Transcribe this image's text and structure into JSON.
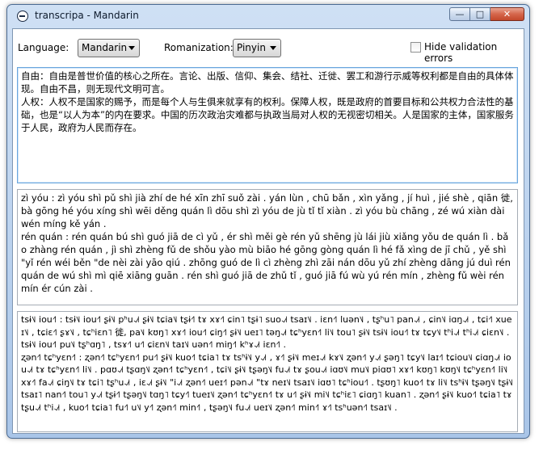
{
  "window": {
    "title": "transcripa - Mandarin",
    "min_glyph": "—",
    "max_glyph": "□",
    "close_glyph": "✕"
  },
  "toolbar": {
    "language_label": "Language:",
    "language_value": "Mandarin",
    "romanization_label": "Romanization:",
    "romanization_value": "Pinyin",
    "hide_validation_label": "Hide validation errors",
    "hide_validation_checked": false
  },
  "source_text": "自由：自由是普世价值的核心之所在。言论、出版、信仰、集会、结社、迁徙、罢工和游行示威等权利都是自由的具体体现。自由不昌，则无现代文明可言。\n人权：人权不是国家的赐予，而是每个人与生俱来就享有的权利。保障人权，既是政府的首要目标和公共权力合法性的基础，也是“以人为本”的内在要求。中国的历次政治灾难都与执政当局对人权的无视密切相关。人是国家的主体，国家服务于人民，政府为人民而存在。",
  "pinyin_text": "zì yóu : zì yóu shì pǔ shì jià zhí de hé xīn zhī suǒ zài . yán lùn , chū bǎn , xìn yǎng , jí huì , jié shè , qiān 徙, bà gōng hé yóu xíng shì wēi děng quán lì dōu shì zì yóu de jù tǐ tǐ xiàn . zì yóu bù chāng , zé wú xiàn dài wén míng kě yán .\nrén quán : rén quán bú shì guó jiā de cì yǔ , ér shì měi gè rén yǔ shēng jù lái jiù xiǎng yǒu de quán lì . bǎo zhàng rén quán , jì shì zhèng fǔ de shǒu yào mù biāo hé gōng gòng quán lì hé fǎ xìng de jī chǔ , yě shì \"yǐ rén wéi běn \"de nèi zài yāo qiú . zhōng guó de lì cì zhèng zhì zāi nán dōu yǔ zhí zhèng dāng jú duì rén quán de wú shì mì qiē xiāng guān . rén shì guó jiā de zhǔ tǐ , guó jiā fú wù yú rén mín , zhèng fǔ wèi rén mín ér cún zài .",
  "ipa_text": "tsɨ˥˩ iou˧˥ : tsɨ˥˩ iou˧˥ ʂɨ˥˩ pʰu˨˩˦ ʂɨ˥˩ tɕia˥˩ tʂɨ˧˥ tɤ xɤ˧˥ ɕin˥ tʂɨ˥ suo˨˩˦ tsaɪ˥˩ . iɛn˧˥ luən˥˩ , tʂʰu˥ pan˨˩˦ , ɕin˥˩ iɑŋ˨˩˦ , tɕi˧˥ xueɪ˥˩ , tɕiɛ˧˥ ʂɤ˥˩ , tɕʰiɛn˥ 徙, pa˥˩ kʊŋ˥ xɤ˧˥ iou˧˥ ɕiŋ˧˥ ʂɨ˥˩ ueɪ˥ təŋ˨˩˦ tɕʰyɛn˧˥ li˥˩ tou˥ ʂɨ˥˩ tsɨ˥˩ iou˧˥ tɤ tɕy˥˩ tʰi˨˩˦ tʰi˨˩˦ ɕiɛn˥˩ . tsɨ˥˩ iou˧˥ pu˥˩ tʂʰɑŋ˥ , tsɤ˧˥ u˧˥ ɕiɛn˥˩ taɪ˥˩ uən˧˥ miŋ˧˥ kʰɤ˨˩˦ iɛn˧˥ .\nʐən˧˥ tɕʰyɛn˧˥ : ʐən˧˥ tɕʰyɛn˧˥ pu˧˥ ʂɨ˥˩ kuo˧˥ tɕia˥ tɤ tsʰɨ˥˩ y˨˩˦ , ɤ˧˥ ʂɨ˥˩ meɪ˨˩˦ kɤ˥˩ ʐən˧˥ y˨˩˦ ʂəŋ˥ tɕy˥˩ laɪ˧˥ tɕiou˥˩ ɕiɑŋ˨˩˦ iou˨˩˦ tɤ tɕʰyɛn˧˥ li˥˩ . pɑʊ˨˩˦ tʂɑŋ˥˩ ʐən˧˥ tɕʰyɛn˧˥ , tɕi˥˩ ʂɨ˥˩ tʂəŋ˥˩ fu˨˩˦ tɤ ʂou˨˩˦ iɑʊ˥˩ mu˥˩ piɑʊ˥ xɤ˧˥ kʊŋ˥ kʊŋ˥˩ tɕʰyɛn˧˥ li˥˩ xɤ˧˥ fa˨˩˦ ɕiŋ˥˩ tɤ tɕi˥ tʂʰu˨˩˦ , iɛ˨˩˦ ʂɨ˥˩ \"i˨˩˦ ʐən˧˥ ueɪ˧˥ pən˨˩˦ \"tɤ neɪ˥˩ tsaɪ˥˩ iɑʊ˥ tɕʰiou˧˥ . tʂʊŋ˥ kuo˧˥ tɤ li˥˩ tsʰɨ˥˩ tʂəŋ˥˩ tʂɨ˥˩ tsaɪ˥ nan˧˥ tou˥ y˨˩˦ tʂɨ˧˥ tʂəŋ˥˩ tɑŋ˥ tɕy˧˥ tueɪ˥˩ ʐən˧˥ tɕʰyɛn˧˥ tɤ u˧˥ ʂɨ˥˩ mi˥˩ tɕʰiɛ˥ ɕiɑŋ˥ kuan˥ . ʐən˧˥ ʂɨ˥˩ kuo˧˥ tɕia˥ tɤ tʂu˨˩˦ tʰi˨˩˦ , kuo˧˥ tɕia˥ fu˧˥ u˥˩ y˧˥ ʐən˧˥ min˧˥ , tʂəŋ˥˩ fu˨˩˦ ueɪ˥˩ ʐən˧˥ min˧˥ ɤ˧˥ tsʰuən˧˥ tsaɪ˥˩ ."
}
